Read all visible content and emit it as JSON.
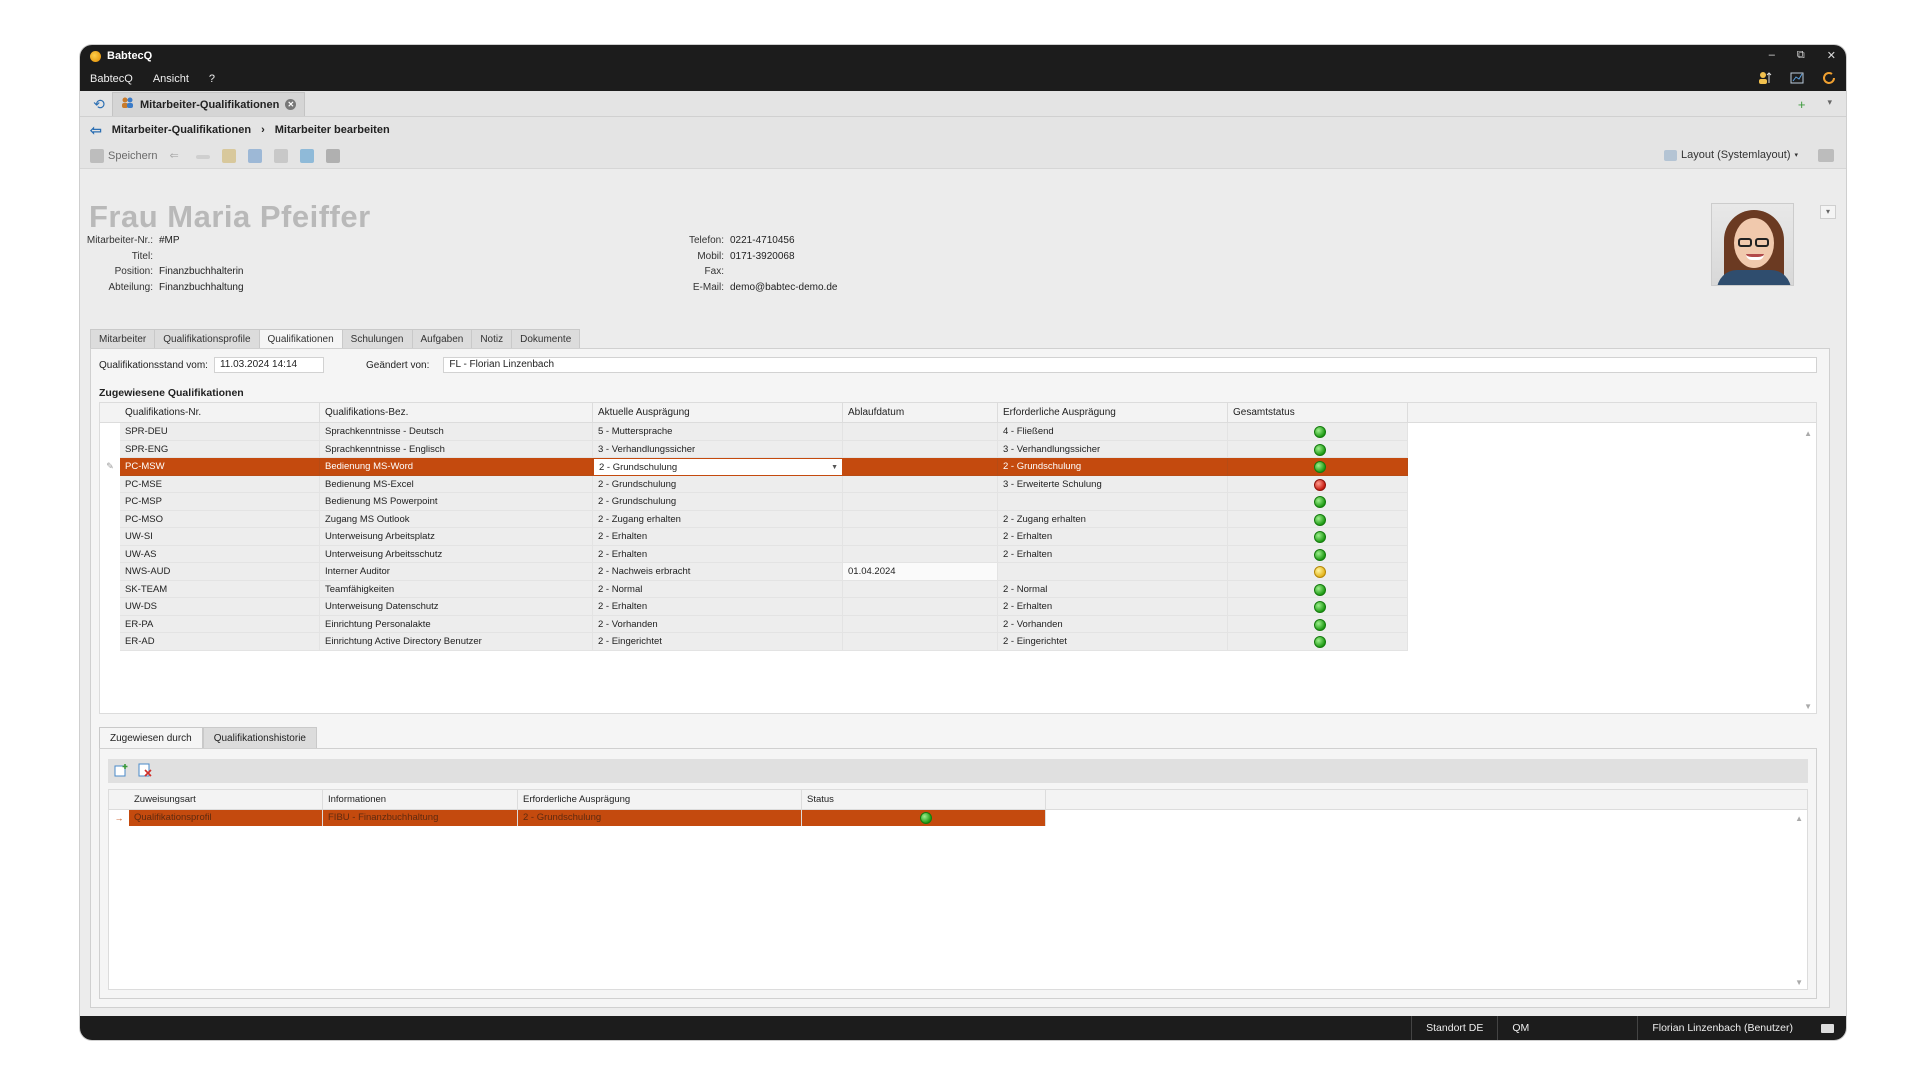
{
  "app": {
    "title": "BabtecQ"
  },
  "menu": [
    "BabtecQ",
    "Ansicht",
    "?"
  ],
  "doc_tab": {
    "label": "Mitarbeiter-Qualifikationen"
  },
  "breadcrumb": [
    "Mitarbeiter-Qualifikationen",
    "Mitarbeiter bearbeiten"
  ],
  "toolbar": {
    "save_label": "Speichern",
    "layout_label": "Layout (Systemlayout)"
  },
  "person": {
    "name": "Frau Maria Pfeiffer",
    "fields_left": [
      {
        "label": "Mitarbeiter-Nr.:",
        "value": "#MP"
      },
      {
        "label": "Titel:",
        "value": ""
      },
      {
        "label": "Position:",
        "value": "Finanzbuchhalterin"
      },
      {
        "label": "Abteilung:",
        "value": "Finanzbuchhaltung"
      }
    ],
    "fields_right": [
      {
        "label": "Telefon:",
        "value": "0221-4710456"
      },
      {
        "label": "Mobil:",
        "value": "0171-3920068"
      },
      {
        "label": "Fax:",
        "value": ""
      },
      {
        "label": "E-Mail:",
        "value": "demo@babtec-demo.de"
      }
    ]
  },
  "subtabs": [
    "Mitarbeiter",
    "Qualifikationsprofile",
    "Qualifikationen",
    "Schulungen",
    "Aufgaben",
    "Notiz",
    "Dokumente"
  ],
  "qual_header": {
    "stand_label": "Qualifikationsstand vom:",
    "stand_value": "11.03.2024 14:14",
    "changed_label": "Geändert von:",
    "changed_value": "FL - Florian Linzenbach",
    "section_title": "Zugewiesene Qualifikationen"
  },
  "grid": {
    "columns": [
      "Qualifikations-Nr.",
      "Qualifikations-Bez.",
      "Aktuelle Ausprägung",
      "Ablaufdatum",
      "Erforderliche Ausprägung",
      "Gesamtstatus"
    ],
    "rows": [
      {
        "nr": "SPR-DEU",
        "bez": "Sprachkenntnisse - Deutsch",
        "akt": "5 - Muttersprache",
        "ablauf": "",
        "erf": "4 - Fließend",
        "status": "green"
      },
      {
        "nr": "SPR-ENG",
        "bez": "Sprachkenntnisse - Englisch",
        "akt": "3 - Verhandlungssicher",
        "ablauf": "",
        "erf": "3 - Verhandlungssicher",
        "status": "green"
      },
      {
        "nr": "PC-MSW",
        "bez": "Bedienung MS-Word",
        "akt": "2 - Grundschulung",
        "ablauf": "",
        "erf": "2 - Grundschulung",
        "status": "green"
      },
      {
        "nr": "PC-MSE",
        "bez": "Bedienung MS-Excel",
        "akt": "2 - Grundschulung",
        "ablauf": "",
        "erf": "3 - Erweiterte Schulung",
        "status": "red"
      },
      {
        "nr": "PC-MSP",
        "bez": "Bedienung MS Powerpoint",
        "akt": "2 - Grundschulung",
        "ablauf": "",
        "erf": "",
        "status": "green"
      },
      {
        "nr": "PC-MSO",
        "bez": "Zugang MS Outlook",
        "akt": "2 - Zugang erhalten",
        "ablauf": "",
        "erf": "2 - Zugang erhalten",
        "status": "green"
      },
      {
        "nr": "UW-SI",
        "bez": "Unterweisung Arbeitsplatz",
        "akt": "2 - Erhalten",
        "ablauf": "",
        "erf": "2 - Erhalten",
        "status": "green"
      },
      {
        "nr": "UW-AS",
        "bez": "Unterweisung Arbeitsschutz",
        "akt": "2 - Erhalten",
        "ablauf": "",
        "erf": "2 - Erhalten",
        "status": "green"
      },
      {
        "nr": "NWS-AUD",
        "bez": "Interner Auditor",
        "akt": "2 - Nachweis erbracht",
        "ablauf": "01.04.2024",
        "erf": "",
        "status": "yellow"
      },
      {
        "nr": "SK-TEAM",
        "bez": "Teamfähigkeiten",
        "akt": "2 - Normal",
        "ablauf": "",
        "erf": "2 - Normal",
        "status": "green"
      },
      {
        "nr": "UW-DS",
        "bez": "Unterweisung Datenschutz",
        "akt": "2 - Erhalten",
        "ablauf": "",
        "erf": "2 - Erhalten",
        "status": "green"
      },
      {
        "nr": "ER-PA",
        "bez": "Einrichtung Personalakte",
        "akt": "2 - Vorhanden",
        "ablauf": "",
        "erf": "2 - Vorhanden",
        "status": "green"
      },
      {
        "nr": "ER-AD",
        "bez": "Einrichtung Active Directory Benutzer",
        "akt": "2 - Eingerichtet",
        "ablauf": "",
        "erf": "2 - Eingerichtet",
        "status": "green"
      }
    ],
    "selected_index": 2
  },
  "bottom_tabs": [
    "Zugewiesen durch",
    "Qualifikationshistorie"
  ],
  "bottom_grid": {
    "columns": [
      "Zuweisungsart",
      "Informationen",
      "Erforderliche Ausprägung",
      "Status"
    ],
    "rows": [
      {
        "art": "Qualifikationsprofil",
        "info": "FIBU - Finanzbuchhaltung",
        "erf": "2 - Grundschulung",
        "status": "green"
      }
    ]
  },
  "statusbar": {
    "standort": "Standort DE",
    "module": "QM",
    "user": "Florian Linzenbach (Benutzer)"
  },
  "colors": {
    "accent": "#c44a0e",
    "titlebar": "#1c1c1c"
  }
}
